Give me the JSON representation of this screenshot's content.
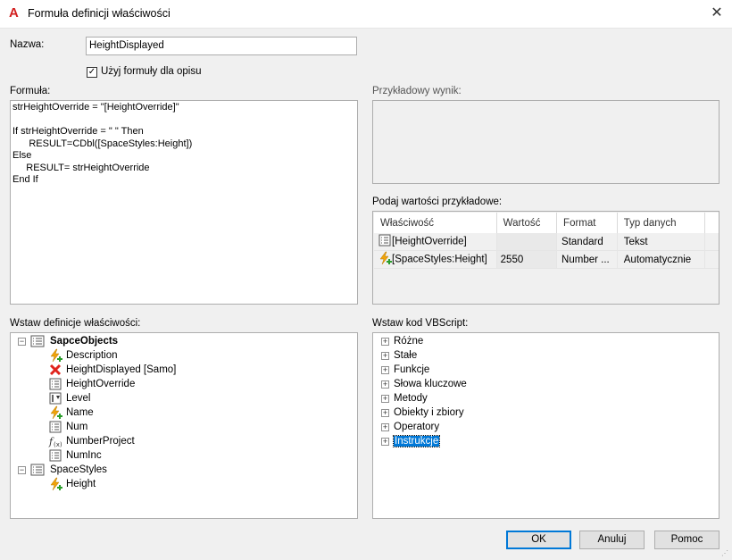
{
  "window": {
    "title": "Formuła definicji właściwości",
    "app_icon": "autocad-logo-icon"
  },
  "name_field": {
    "label": "Nazwa:",
    "value": "HeightDisplayed"
  },
  "use_formula_checkbox": {
    "label": "Użyj formuły dla opisu",
    "checked": true
  },
  "formula": {
    "label": "Formuła:",
    "lines": [
      "strHeightOverride = \"[HeightOverride]\"",
      "",
      "If strHeightOverride = \" \" Then",
      "      RESULT=CDbl([SpaceStyles:Height])",
      "Else",
      "     RESULT= strHeightOverride",
      "End If"
    ]
  },
  "sample_result": {
    "label": "Przykładowy wynik:"
  },
  "sample_values": {
    "label": "Podaj wartości przykładowe:",
    "columns": [
      "Właściwość",
      "Wartość",
      "Format",
      "Typ danych"
    ],
    "rows": [
      {
        "icon": "property-list-icon",
        "property": "[HeightOverride]",
        "value": "",
        "format": "Standard",
        "type": "Tekst"
      },
      {
        "icon": "auto-property-icon",
        "property": "[SpaceStyles:Height]",
        "value": "2550",
        "format": "Number ...",
        "type": "Automatycznie"
      }
    ]
  },
  "property_tree": {
    "label": "Wstaw definicje właściwości:",
    "groups": [
      {
        "name": "SapceObjects",
        "bold": true,
        "items": [
          {
            "label": "Description",
            "icon": "auto-property-icon"
          },
          {
            "label": "HeightDisplayed [Samo]",
            "icon": "red-x-icon"
          },
          {
            "label": "HeightOverride",
            "icon": "property-list-icon"
          },
          {
            "label": "Level",
            "icon": "level-property-icon"
          },
          {
            "label": "Name",
            "icon": "auto-property-icon"
          },
          {
            "label": "Num",
            "icon": "property-list-icon"
          },
          {
            "label": "NumberProject",
            "icon": "formula-icon"
          },
          {
            "label": "NumInc",
            "icon": "property-list-icon"
          }
        ]
      },
      {
        "name": "SpaceStyles",
        "bold": false,
        "items": [
          {
            "label": "Height",
            "icon": "auto-property-icon"
          }
        ]
      }
    ]
  },
  "vbscript_tree": {
    "label": "Wstaw kod VBScript:",
    "items": [
      "Różne",
      "Stałe",
      "Funkcje",
      "Słowa kluczowe",
      "Metody",
      "Obiekty i zbiory",
      "Operatory",
      "Instrukcje"
    ],
    "selected": "Instrukcje"
  },
  "buttons": {
    "ok": "OK",
    "cancel": "Anuluj",
    "help": "Pomoc"
  },
  "colors": {
    "accent": "#0078d7",
    "autocad_red": "#d21f1f"
  }
}
